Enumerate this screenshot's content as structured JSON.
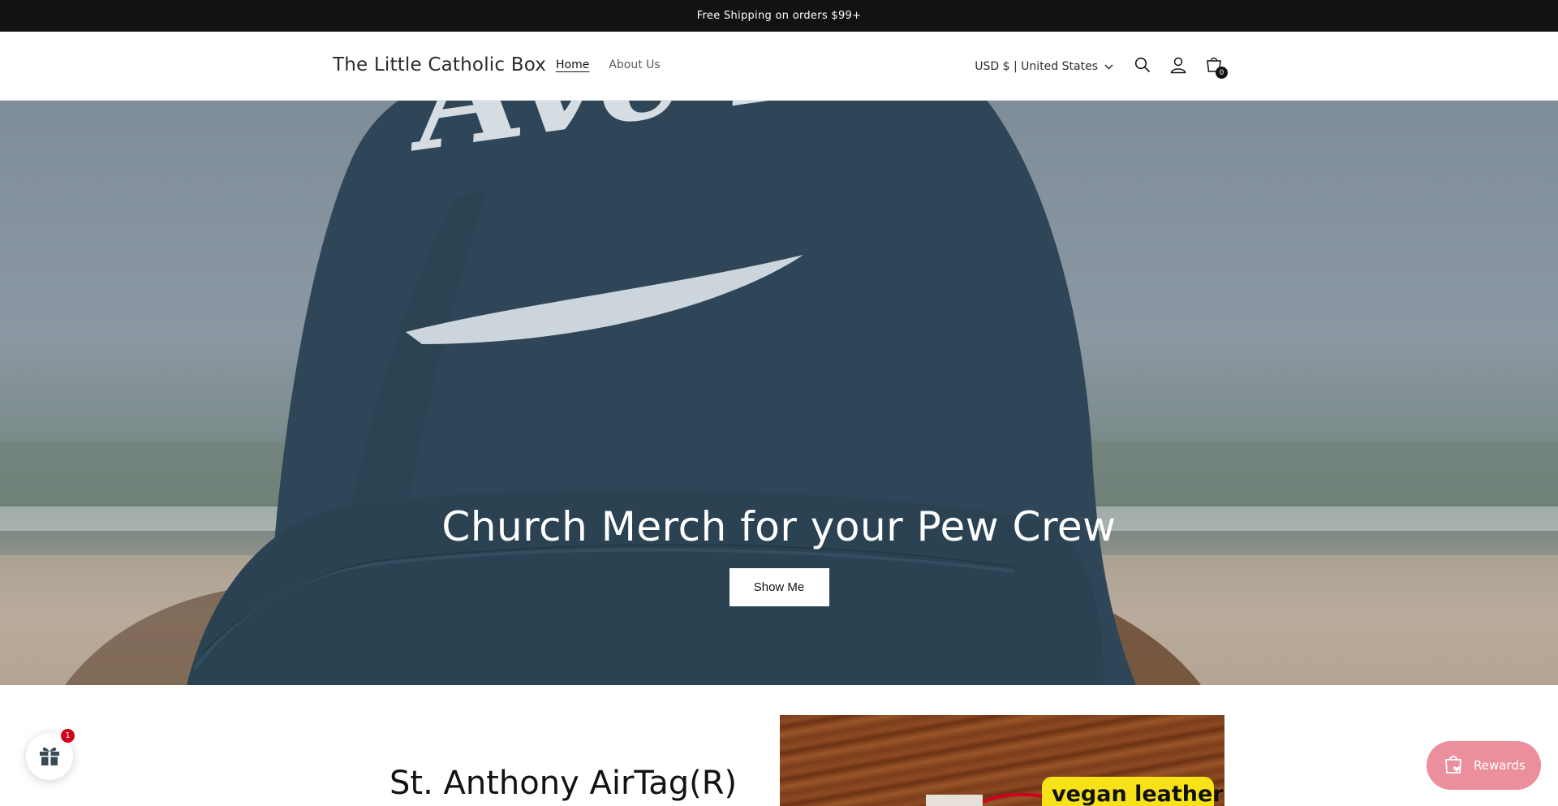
{
  "announcement": {
    "text": "Free Shipping on orders $99+"
  },
  "header": {
    "logo": "The Little Catholic Box",
    "nav": [
      {
        "label": "Home",
        "active": true
      },
      {
        "label": "About Us",
        "active": false
      }
    ],
    "currency": "USD $ | United States",
    "icons": [
      "search-icon",
      "account-icon",
      "cart-icon",
      "chevron-down-icon"
    ],
    "cart_count": "0"
  },
  "hero": {
    "title": "Church Merch for your Pew Crew",
    "button": "Show Me",
    "image_text": "Ave Maria"
  },
  "feature": {
    "title": "St. Anthony AirTag(R)",
    "image_tag": "vegan leather"
  },
  "widgets": {
    "gift_badge": "1",
    "rewards_label": "Rewards"
  },
  "colors": {
    "announcement_bg": "#121212",
    "cap_navy": "#2e4657",
    "rewards_pink": "#eb8f9c",
    "badge_red": "#d0021b",
    "tag_yellow": "#f7e219"
  }
}
